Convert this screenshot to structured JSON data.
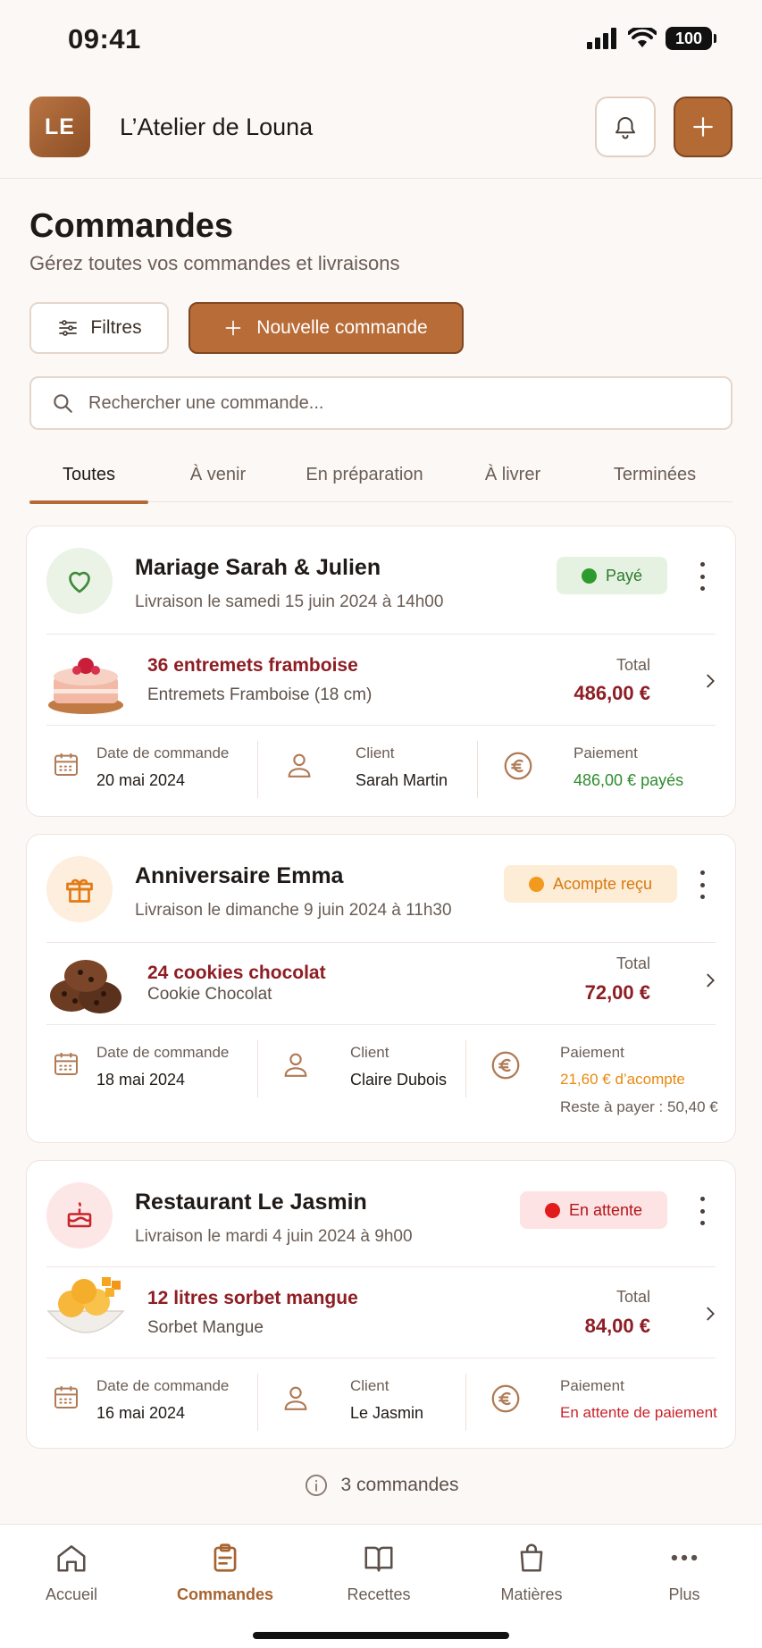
{
  "status_bar": {
    "time": "09:41",
    "battery": "100"
  },
  "header": {
    "logo_initials": "LE",
    "app_name": "L’Atelier de Louna"
  },
  "page": {
    "title": "Commandes",
    "subtitle": "Gérez toutes vos commandes et livraisons",
    "filters_label": "Filtres",
    "new_order_label": "Nouvelle commande",
    "search_placeholder": "Rechercher une commande..."
  },
  "tabs": [
    {
      "label": "Toutes",
      "active": true
    },
    {
      "label": "À venir"
    },
    {
      "label": "En préparation"
    },
    {
      "label": "À livrer"
    },
    {
      "label": "Terminées"
    }
  ],
  "orders": [
    {
      "title": "Mariage Sarah & Julien",
      "delivery": "Livraison le samedi 15 juin 2024 à 14h00",
      "status": "Payé",
      "status_color": "#2e8b2e",
      "product_name": "36 entremets framboise",
      "product_desc": "Entremets Framboise (18 cm)",
      "total_label": "Total",
      "total": "486,00 €",
      "order_date_label": "Date de commande",
      "order_date": "20 mai 2024",
      "client_label": "Client",
      "client": "Sarah Martin",
      "payment_label": "Paiement",
      "payment": "486,00 € payés"
    },
    {
      "title": "Anniversaire Emma",
      "delivery": "Livraison le dimanche 9 juin 2024 à 11h30",
      "status": "Acompte reçu",
      "status_color": "#e8890f",
      "product_name": "24 cookies chocolat",
      "product_desc": "Cookie Chocolat",
      "total_label": "Total",
      "total": "72,00 €",
      "order_date_label": "Date de commande",
      "order_date": "18 mai 2024",
      "client_label": "Client",
      "client": "Claire Dubois",
      "payment_label": "Paiement",
      "payment": "21,60 € d’acompte",
      "payment_remaining": "Reste à payer : 50,40 €"
    },
    {
      "title": "Restaurant Le Jasmin",
      "delivery": "Livraison le mardi 4 juin 2024 à 9h00",
      "status": "En attente",
      "status_color": "#d61f1f",
      "product_name": "12 litres sorbet mangue",
      "product_desc": "Sorbet Mangue",
      "total_label": "Total",
      "total": "84,00 €",
      "order_date_label": "Date de commande",
      "order_date": "16 mai 2024",
      "client_label": "Client",
      "client": "Le Jasmin",
      "payment_label": "Paiement",
      "payment": "En attente de paiement"
    }
  ],
  "footer": {
    "count": "3 commandes"
  },
  "bottom_nav": [
    {
      "label": "Accueil",
      "icon": "home-icon"
    },
    {
      "label": "Commandes",
      "icon": "clipboard-icon",
      "active": true
    },
    {
      "label": "Recettes",
      "icon": "book-icon"
    },
    {
      "label": "Matières",
      "icon": "shopping-bag-icon"
    },
    {
      "label": "Plus",
      "icon": "more-icon"
    }
  ],
  "colors": {
    "accent": "#b46a34",
    "price": "#8e1d24",
    "paid": "#2e8b2e",
    "deposit": "#e8890f",
    "pending": "#d61f1f"
  }
}
